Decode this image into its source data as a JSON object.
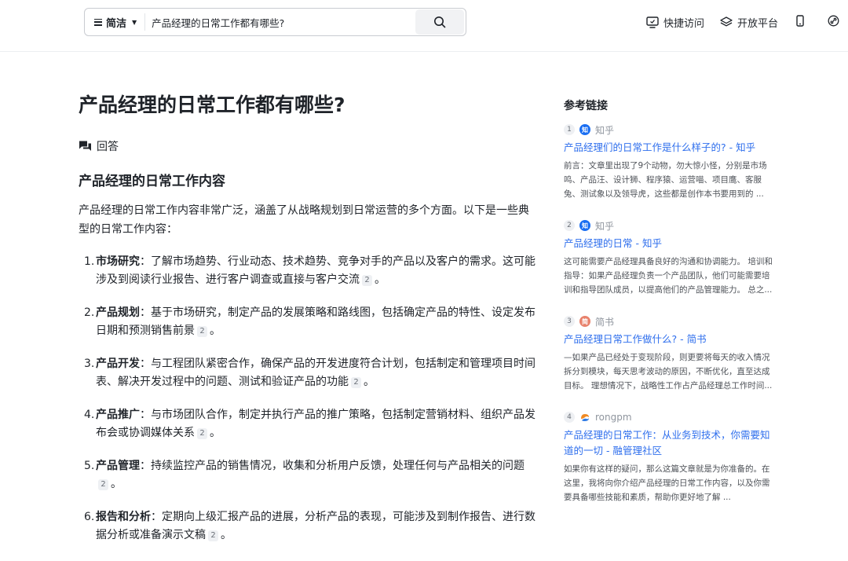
{
  "header": {
    "mode_label": "简洁",
    "search_value": "产品经理的日常工作都有哪些?",
    "nav_quick": "快捷访问",
    "nav_open": "开放平台"
  },
  "main": {
    "title": "产品经理的日常工作都有哪些?",
    "answer_label": "回答",
    "section_title": "产品经理的日常工作内容",
    "intro": "产品经理的日常工作内容非常广泛，涵盖了从战略规划到日常运营的多个方面。以下是一些典型的日常工作内容：",
    "items": [
      {
        "num": "1.",
        "term": "市场研究",
        "text": "：了解市场趋势、行业动态、技术趋势、竞争对手的产品以及客户的需求。这可能涉及到阅读行业报告、进行客户调查或直接与客户交流",
        "cite": "2",
        "end": "。"
      },
      {
        "num": "2.",
        "term": "产品规划",
        "text": "：基于市场研究，制定产品的发展策略和路线图，包括确定产品的特性、设定发布日期和预测销售前景",
        "cite": "2",
        "end": "。"
      },
      {
        "num": "3.",
        "term": "产品开发",
        "text": "：与工程团队紧密合作，确保产品的开发进度符合计划，包括制定和管理项目时间表、解决开发过程中的问题、测试和验证产品的功能",
        "cite": "2",
        "end": "。"
      },
      {
        "num": "4.",
        "term": "产品推广",
        "text": "：与市场团队合作，制定并执行产品的推广策略，包括制定营销材料、组织产品发布会或协调媒体关系",
        "cite": "2",
        "end": "。"
      },
      {
        "num": "5.",
        "term": "产品管理",
        "text": "：持续监控产品的销售情况，收集和分析用户反馈，处理任何与产品相关的问题",
        "cite": "2",
        "end": "。"
      },
      {
        "num": "6.",
        "term": "报告和分析",
        "text": "：定期向上级汇报产品的进展，分析产品的表现，可能涉及到制作报告、进行数据分析或准备演示文稿",
        "cite": "2",
        "end": "。"
      }
    ]
  },
  "refs": {
    "title": "参考链接",
    "items": [
      {
        "num": "1",
        "site": "知乎",
        "logo_char": "知",
        "title": "产品经理们的日常工作是什么样子的? - 知乎",
        "snippet": "前言：文章里出现了9个动物，勿大惊小怪，分别是市场鸣、产品汪、设计狮、程序猿、运营喵、项目鹰、客服兔、测试象以及领导虎，这些都是创作本书要用到的 ..."
      },
      {
        "num": "2",
        "site": "知乎",
        "logo_char": "知",
        "title": "产品经理的日常 - 知乎",
        "snippet": "这可能需要产品经理具备良好的沟通和协调能力。 培训和指导：如果产品经理负责一个产品团队，他们可能需要培训和指导团队成员，以提高他们的产品管理能力。 总之..."
      },
      {
        "num": "3",
        "site": "简书",
        "logo_char": "简",
        "title": "产品经理日常工作做什么? - 简书",
        "snippet": "—如果产品已经处于变现阶段，则更要将每天的收入情况拆分到模块，每天思考波动的原因，不断优化，直至达成目标。 理想情况下，战略性工作占产品经理总工作时间..."
      },
      {
        "num": "4",
        "site": "rongpm",
        "logo_char": "",
        "title": "产品经理的日常工作：从业务到技术，你需要知道的一切 - 融管理社区",
        "snippet": "如果你有这样的疑问，那么这篇文章就是为你准备的。在这里，我将向你介绍产品经理的日常工作内容，以及你需要具备哪些技能和素质，帮助你更好地了解 ..."
      }
    ]
  },
  "colors": {
    "accent_link": "#2f6fed",
    "zhihu_brand": "#1a6ef2",
    "jianshu_brand": "#e8816b"
  }
}
